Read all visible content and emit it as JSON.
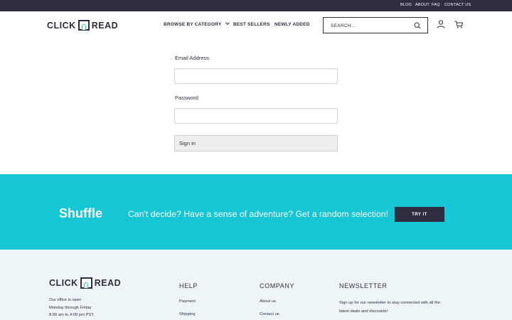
{
  "topbar": {
    "links": [
      "Blog",
      "About",
      "FAQ",
      "Contact Us"
    ]
  },
  "header": {
    "logo_left": "CLICK",
    "logo_right": "READ",
    "nav": {
      "browse": "Browse by Category",
      "best_sellers": "Best Sellers",
      "newly_added": "Newly Added"
    },
    "search": {
      "placeholder": "SEARCH...",
      "value": ""
    },
    "icons": [
      "search-icon",
      "user-icon",
      "cart-icon"
    ]
  },
  "login": {
    "email_label": "Email Address",
    "email_value": "",
    "password_label": "Password",
    "password_value": "",
    "submit_label": "Sign in"
  },
  "banner": {
    "title": "Shuffle",
    "text": "Can't decide? Have a sense of adventure? Get a random selection!",
    "button": "Try It"
  },
  "footer": {
    "logo_left": "CLICK",
    "logo_right": "READ",
    "office": [
      "Our office is open",
      "Monday through Friday",
      "8:00 am to 4:00 pm PST."
    ],
    "help": {
      "heading": "Help",
      "links": [
        "Payment",
        "Shipping"
      ]
    },
    "company": {
      "heading": "Company",
      "links": [
        "About us",
        "Contact us"
      ]
    },
    "newsletter": {
      "heading": "Newsletter",
      "text": "Sign up for our newsletter to stay connected with all the latest deals and discounts!"
    }
  },
  "colors": {
    "dark": "#2f2d40",
    "accent": "#16c6d4",
    "footer_bg": "#eef5f6",
    "button_bg": "#eeeeee"
  }
}
